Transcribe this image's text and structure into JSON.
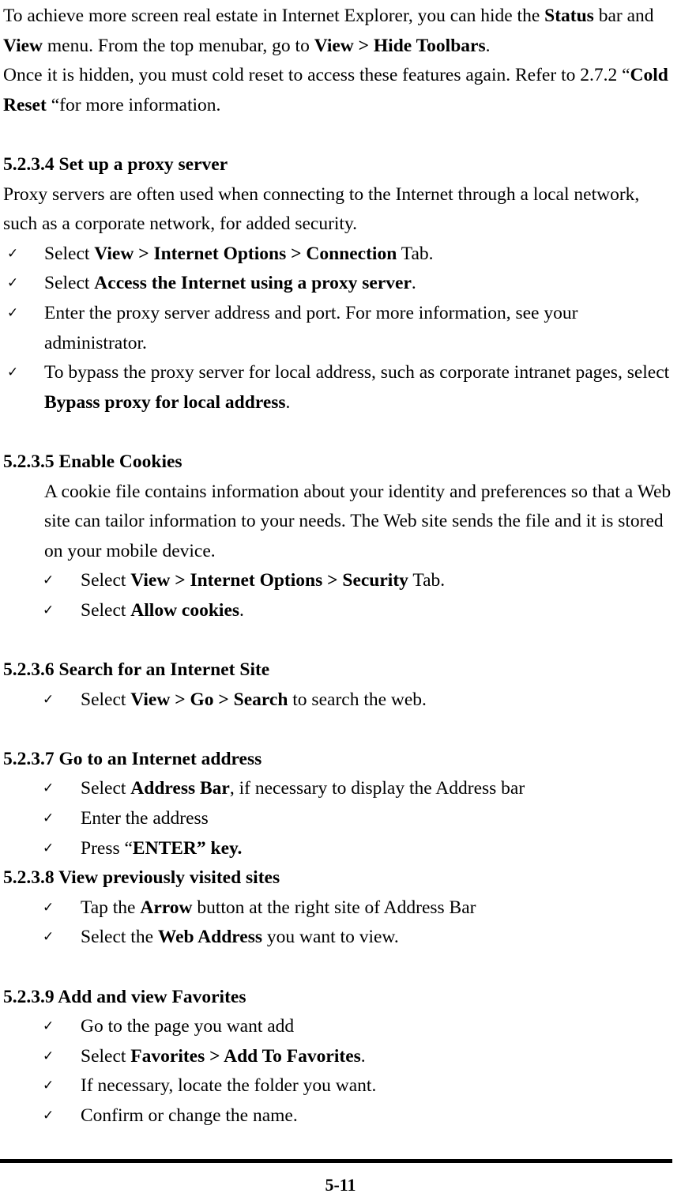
{
  "document": {
    "intro": {
      "line1_a": "To achieve more screen real estate in Internet Explorer, you can hide the ",
      "line1_b": "Status",
      "line1_c": " bar and ",
      "line1_d": "View",
      "line1_e": " menu. From the top menubar, go to ",
      "line1_f": "View > Hide Toolbars",
      "line1_g": ".",
      "line2_a": "Once it is hidden, you must cold reset to access these features again. Refer to 2.7.2 “",
      "line2_b": "Cold Reset",
      "line2_c": " “for more information."
    },
    "sections": [
      {
        "id": "5.2.3.4",
        "heading": "5.2.3.4 Set up a proxy server",
        "paragraph": "Proxy servers are often used when connecting to the Internet through a local network, such as a corporate network, for added security.",
        "bullets": [
          {
            "pre": "Select ",
            "bold": "View > Internet Options > Connection",
            "post": " Tab."
          },
          {
            "pre": "Select ",
            "bold": "Access the Internet using a proxy server",
            "post": "."
          },
          {
            "pre": "Enter the proxy server address and port. For more information, see your administrator.",
            "bold": "",
            "post": ""
          },
          {
            "pre": "To bypass the proxy server for local address, such as corporate intranet pages, select ",
            "bold": "Bypass proxy for local address",
            "post": "."
          }
        ]
      },
      {
        "id": "5.2.3.5",
        "heading": "5.2.3.5 Enable Cookies",
        "paragraph": "A cookie file contains information about your identity and preferences so that a Web site can tailor information to your needs. The Web site sends the file and it is stored on your mobile device.",
        "bullets": [
          {
            "pre": "Select ",
            "bold": "View > Internet Options > Security",
            "post": " Tab."
          },
          {
            "pre": "Select ",
            "bold": "Allow cookies",
            "post": "."
          }
        ]
      },
      {
        "id": "5.2.3.6",
        "heading": "5.2.3.6 Search for an Internet Site",
        "bullets": [
          {
            "pre": "Select ",
            "bold": "View > Go > Search",
            "post": " to search the web."
          }
        ]
      },
      {
        "id": "5.2.3.7",
        "heading": "5.2.3.7 Go to an Internet address",
        "bullets": [
          {
            "pre": "Select ",
            "bold": "Address Bar",
            "post": ", if necessary to display the Address bar"
          },
          {
            "pre": "Enter the address",
            "bold": "",
            "post": ""
          },
          {
            "pre": "Press “",
            "bold": "ENTER” key.",
            "post": ""
          }
        ]
      },
      {
        "id": "5.2.3.8",
        "heading": "5.2.3.8 View previously visited sites",
        "bullets": [
          {
            "pre": "Tap the ",
            "bold": "Arrow",
            "post": " button at the right site of Address Bar"
          },
          {
            "pre": "Select the ",
            "bold": "Web Address",
            "post": " you want to view."
          }
        ]
      },
      {
        "id": "5.2.3.9",
        "heading": "5.2.3.9 Add and view Favorites",
        "bullets": [
          {
            "pre": "Go to the page you want add",
            "bold": "",
            "post": ""
          },
          {
            "pre": "Select ",
            "bold": "Favorites > Add To Favorites",
            "post": "."
          },
          {
            "pre": "If necessary, locate the folder you want.",
            "bold": "",
            "post": ""
          },
          {
            "pre": "Confirm or change the name.",
            "bold": "",
            "post": ""
          }
        ]
      }
    ],
    "bullet_marker": "✓",
    "footer": {
      "page_number": "5-11"
    }
  }
}
